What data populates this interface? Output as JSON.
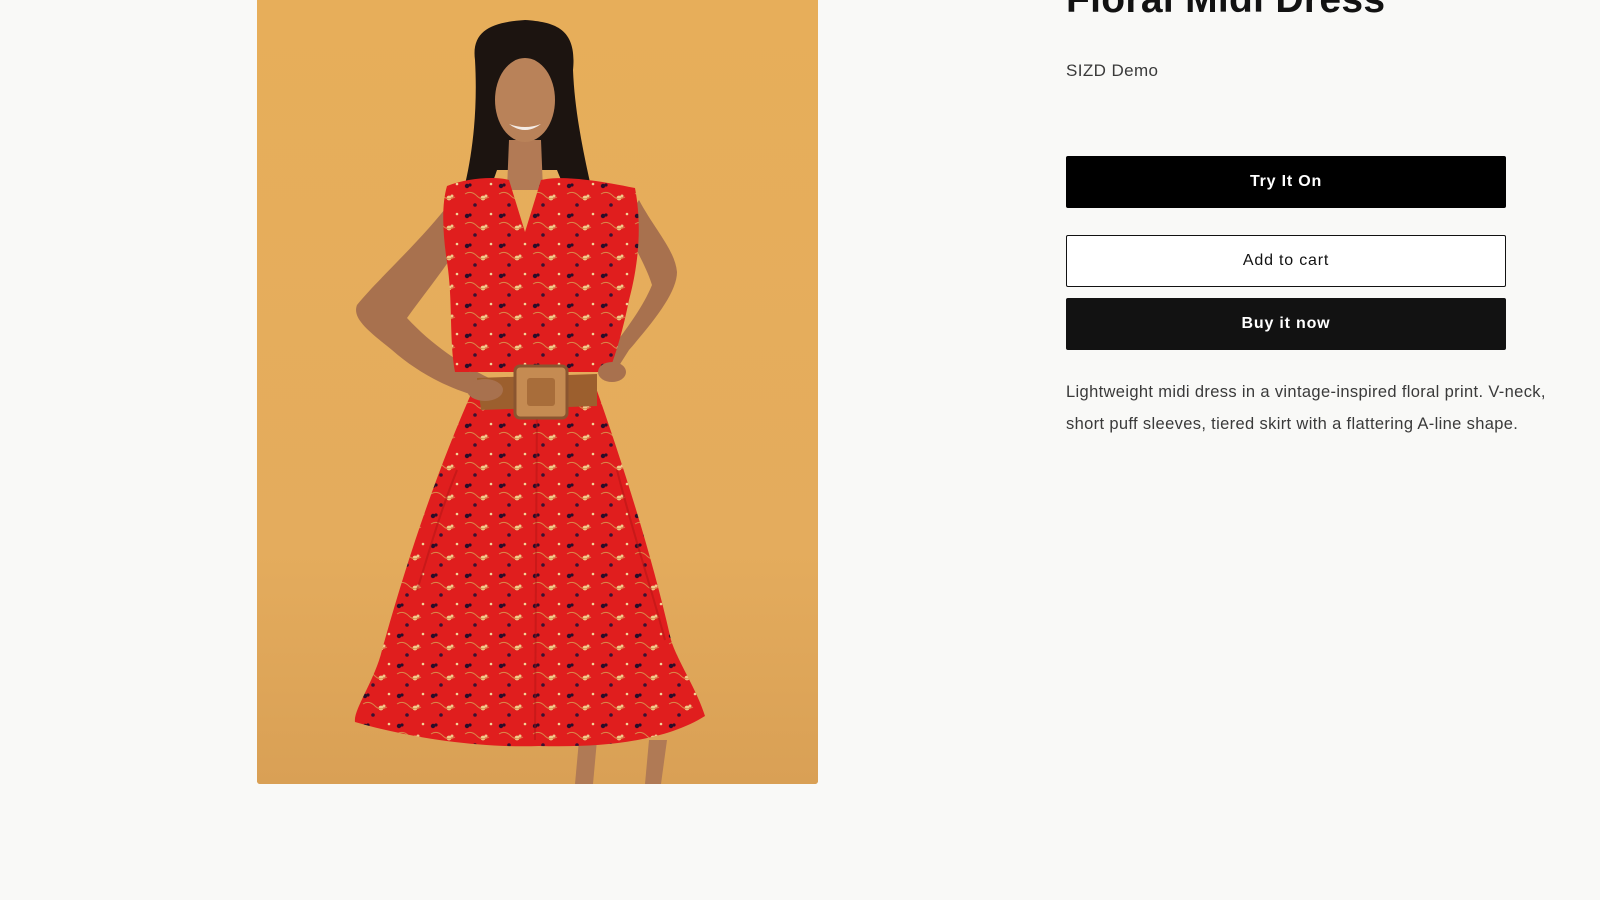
{
  "product": {
    "title": "Floral Midi Dress",
    "vendor": "SIZD Demo",
    "description": "Lightweight midi dress in a vintage-inspired floral print. V-neck, short puff sleeves, tiered skirt with a flattering A-line shape."
  },
  "actions": {
    "try_on_label": "Try It On",
    "add_to_cart_label": "Add to cart",
    "buy_now_label": "Buy it now"
  },
  "colors": {
    "background": "#f9f9f7",
    "photo_backdrop": "#e3ac5c",
    "dress": "#e01e1e",
    "primary_button": "#000000",
    "buy_button": "#121212"
  }
}
